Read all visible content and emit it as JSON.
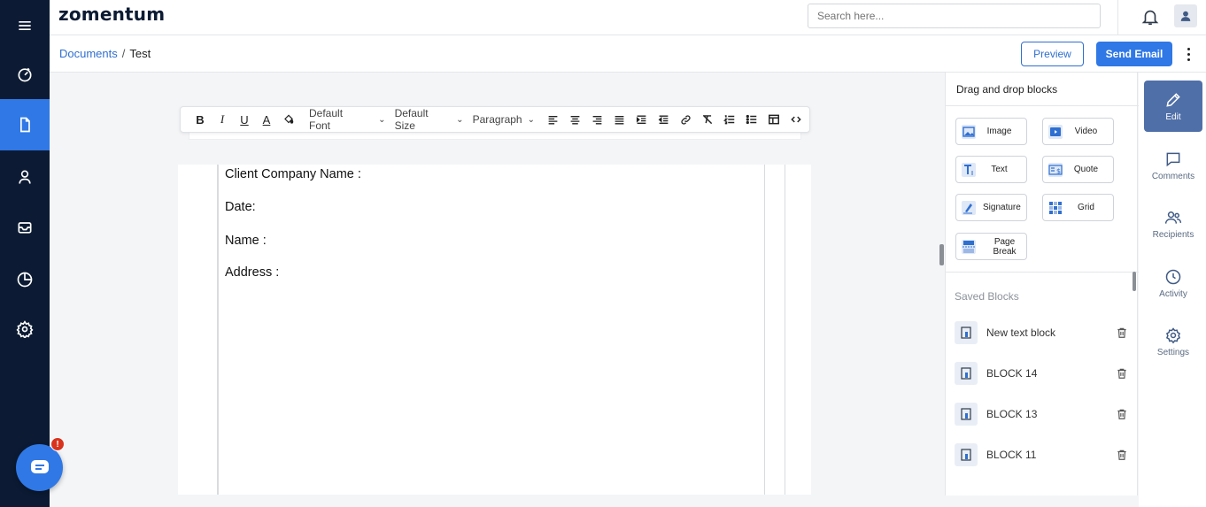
{
  "app": {
    "logo_text": "zomentum"
  },
  "search": {
    "placeholder": "Search here..."
  },
  "breadcrumb": {
    "parent": "Documents",
    "separator": "/",
    "current": "Test"
  },
  "actions": {
    "preview_label": "Preview",
    "send_label": "Send Email"
  },
  "toolbar": {
    "font": "Default Font",
    "size": "Default Size",
    "block_type": "Paragraph",
    "icons": [
      "bold-icon",
      "italic-icon",
      "underline-icon",
      "text-color-icon",
      "highlight-icon",
      "align-left-icon",
      "align-center-icon",
      "align-right-icon",
      "align-justify-icon",
      "indent-icon",
      "outdent-icon",
      "link-icon",
      "clear-format-icon",
      "ordered-list-icon",
      "bullet-list-icon",
      "table-icon",
      "code-icon"
    ]
  },
  "document": {
    "lines": [
      "Client Company Name :",
      "Date:",
      "Name :",
      "Address :"
    ]
  },
  "blocks_panel": {
    "title": "Drag and drop blocks",
    "blocks": [
      {
        "label": "Image",
        "icon": "image-icon"
      },
      {
        "label": "Video",
        "icon": "video-icon"
      },
      {
        "label": "Text",
        "icon": "text-icon"
      },
      {
        "label": "Quote",
        "icon": "quote-icon"
      },
      {
        "label": "Signature",
        "icon": "signature-icon"
      },
      {
        "label": "Grid",
        "icon": "grid-icon"
      },
      {
        "label": "Page Break",
        "icon": "page-break-icon"
      }
    ],
    "saved_title": "Saved Blocks",
    "saved": [
      "New text block",
      "BLOCK 14",
      "BLOCK 13",
      "BLOCK 11"
    ]
  },
  "rail": {
    "items": [
      {
        "label": "Edit",
        "icon": "pencil-icon"
      },
      {
        "label": "Comments",
        "icon": "comment-icon"
      },
      {
        "label": "Recipients",
        "icon": "users-icon"
      },
      {
        "label": "Activity",
        "icon": "clock-icon"
      },
      {
        "label": "Settings",
        "icon": "gear-icon"
      }
    ]
  },
  "chat": {
    "badge": "!"
  },
  "colors": {
    "nav_bg": "#0c1b33",
    "accent": "#2f78e6",
    "rail_active": "#4f6fa8",
    "logo_accent": "#0fbf7a"
  }
}
